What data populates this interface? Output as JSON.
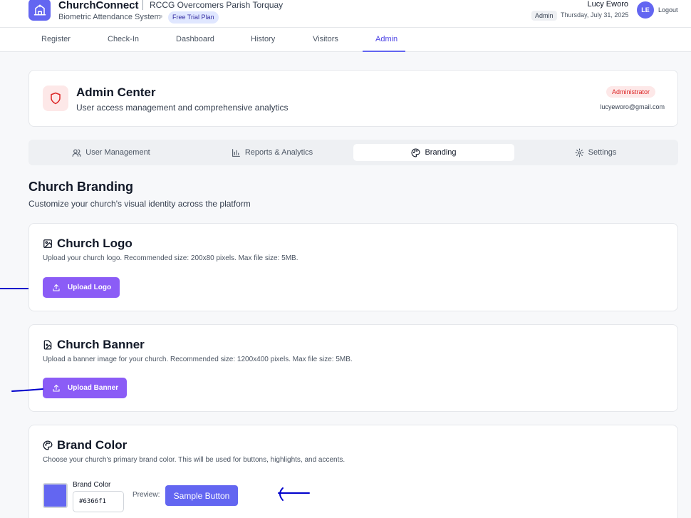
{
  "header": {
    "app_name": "ChurchConnect",
    "church_name": "RCCG Overcomers Parish Torquay",
    "subtitle": "Biometric Attendance System",
    "plan_badge": "Free Trial Plan",
    "user_name": "Lucy Eworo",
    "role": "Admin",
    "date": "Thursday, July 31, 2025",
    "avatar_initials": "LE",
    "logout": "Logout"
  },
  "nav": {
    "items": [
      {
        "label": "Register"
      },
      {
        "label": "Check-In"
      },
      {
        "label": "Dashboard"
      },
      {
        "label": "History"
      },
      {
        "label": "Visitors"
      },
      {
        "label": "Admin"
      }
    ],
    "active": "Admin"
  },
  "admin": {
    "title": "Admin Center",
    "subtitle": "User access management and comprehensive analytics",
    "badge": "Administrator",
    "email": "lucyeworo@gmail.com"
  },
  "tabs": {
    "items": [
      {
        "label": "User Management",
        "icon": "users-icon"
      },
      {
        "label": "Reports & Analytics",
        "icon": "bar-chart-icon"
      },
      {
        "label": "Branding",
        "icon": "palette-icon"
      },
      {
        "label": "Settings",
        "icon": "gear-icon"
      }
    ],
    "active": "Branding"
  },
  "branding": {
    "title": "Church Branding",
    "subtitle": "Customize your church's visual identity across the platform",
    "logo": {
      "title": "Church Logo",
      "description": "Upload your church logo. Recommended size: 200x80 pixels. Max file size: 5MB.",
      "button": "Upload Logo"
    },
    "banner": {
      "title": "Church Banner",
      "description": "Upload a banner image for your church. Recommended size: 1200x400 pixels. Max file size: 5MB.",
      "button": "Upload Banner"
    },
    "color": {
      "title": "Brand Color",
      "description": "Choose your church's primary brand color. This will be used for buttons, highlights, and accents.",
      "field_label": "Brand Color",
      "value": "#6366f1",
      "preview_label": "Preview:",
      "sample_button": "Sample Button"
    }
  },
  "colors": {
    "primary": "#6366f1",
    "upload_button": "#8b5cf6",
    "admin_badge": "#dc2626",
    "annotation_ink": "#0000cc"
  }
}
